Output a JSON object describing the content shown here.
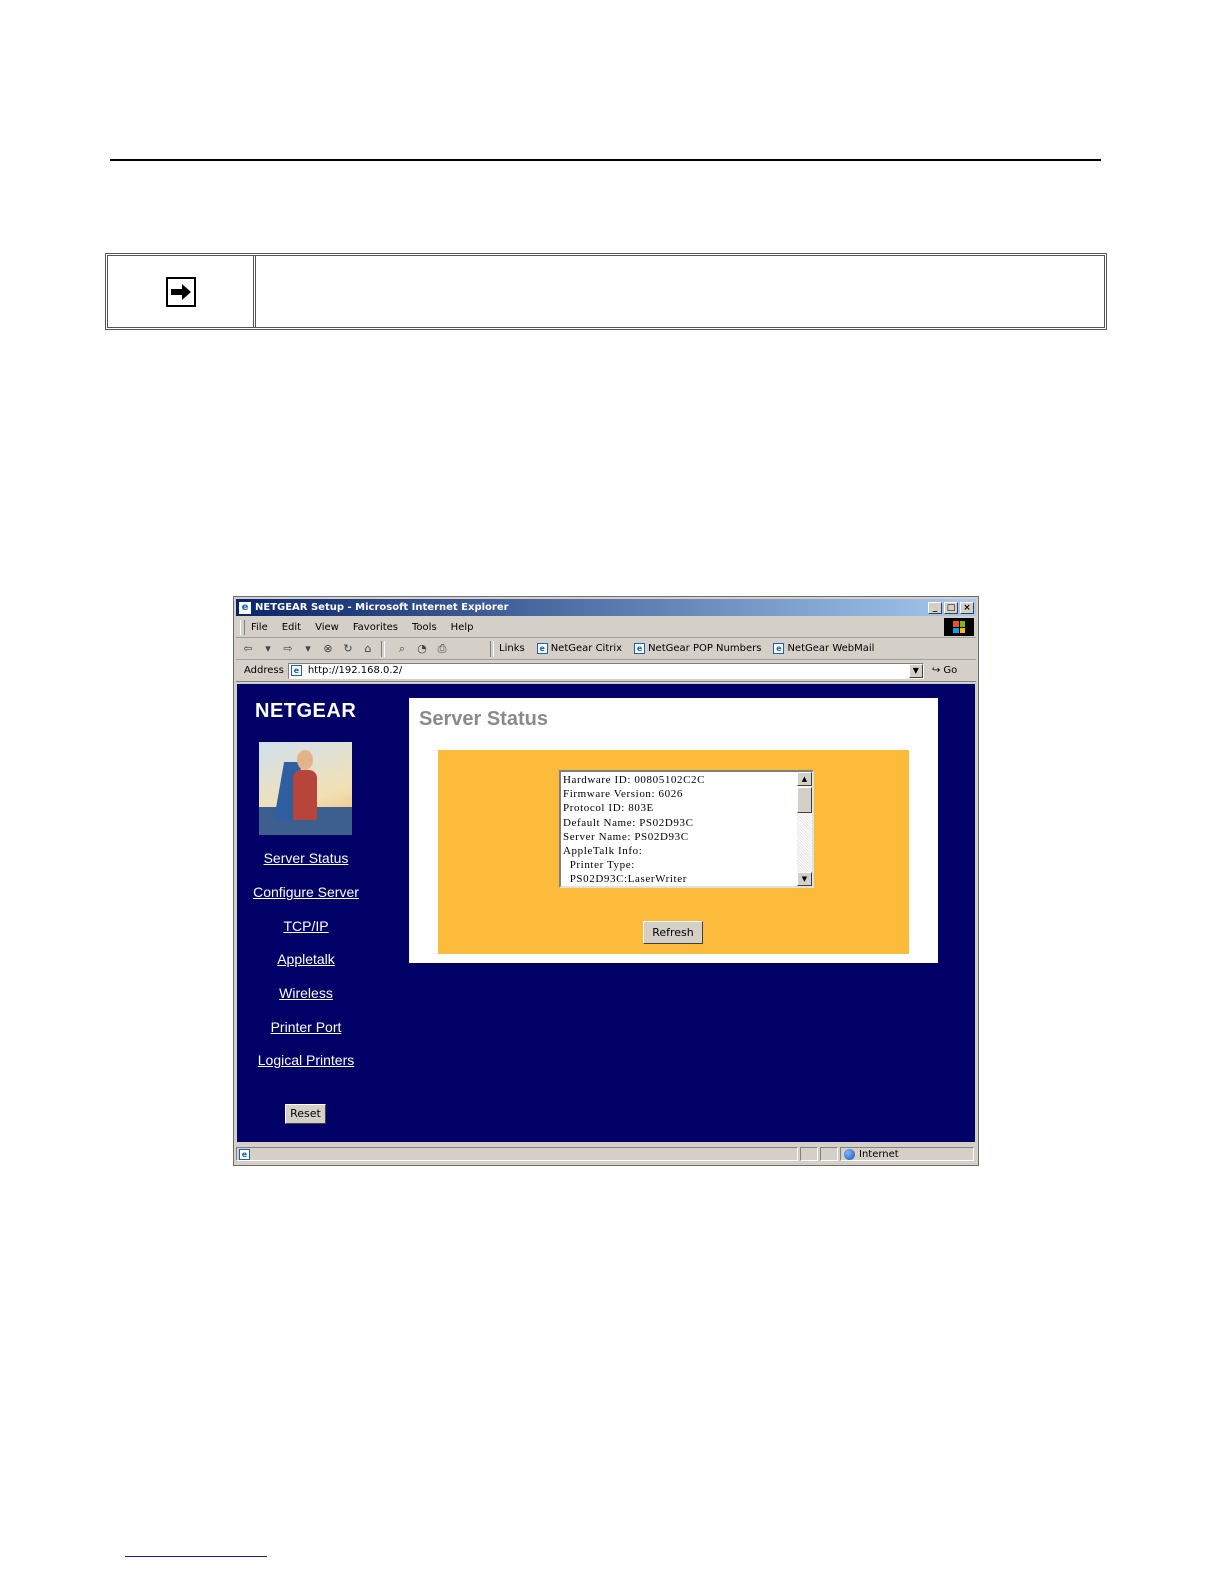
{
  "browser": {
    "title": "NETGEAR Setup - Microsoft Internet Explorer",
    "window_buttons": [
      "_",
      "□",
      "×"
    ],
    "menu": [
      "File",
      "Edit",
      "View",
      "Favorites",
      "Tools",
      "Help"
    ],
    "links_label": "Links",
    "links": [
      "NetGear Citrix",
      "NetGear POP Numbers",
      "NetGear WebMail"
    ],
    "address_label": "Address",
    "address_value": "http://192.168.0.2/",
    "go_label": "Go",
    "status_zone": "Internet"
  },
  "page": {
    "brand": "NETGEAR",
    "title": "Server Status",
    "status_lines": "Hardware ID: 00805102C2C\nFirmware Version: 6026\nProtocol ID: 803E\nDefault Name: PS02D93C\nServer Name: PS02D93C\nAppleTalk Info:\n  Printer Type:\n  PS02D93C:LaserWriter",
    "refresh_label": "Refresh",
    "reset_label": "Reset",
    "nav": [
      "Server Status",
      "Configure Server",
      "TCP/IP",
      "Appletalk",
      "Wireless",
      "Printer Port",
      "Logical Printers"
    ]
  },
  "colors": {
    "sidebar_bg": "#000066",
    "panel_orange": "#fcbb3a"
  }
}
